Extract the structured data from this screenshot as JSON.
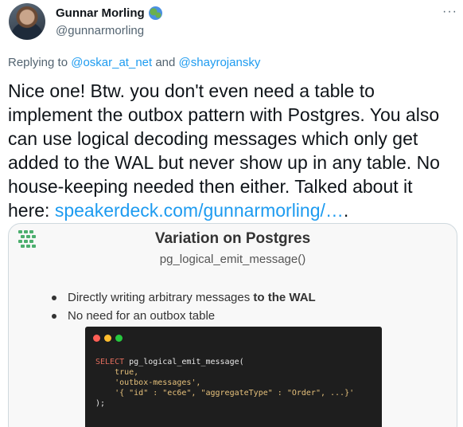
{
  "author": {
    "name": "Gunnar Morling",
    "handle": "@gunnarmorling",
    "badge_icon": "globe-icon"
  },
  "menu": {
    "more_label": "···"
  },
  "reply": {
    "prefix": "Replying to",
    "mention1": "@oskar_at_net",
    "conj": "and",
    "mention2": "@shayrojansky"
  },
  "tweet": {
    "text": "Nice one! Btw. you don't even need a table to implement the outbox pattern with Postgres. You also can use logical decoding messages which only get added to the WAL but never show up in any table. No house-keeping needed then either. Talked about it here: ",
    "link": "speakerdeck.com/gunnarmorling/…",
    "trailing": "."
  },
  "card": {
    "title": "Variation on Postgres",
    "subtitle": "pg_logical_emit_message()",
    "bullets": [
      {
        "text": "Directly writing arbitrary messages ",
        "bold": "to the WAL"
      },
      {
        "text": "No need for an outbox table",
        "bold": ""
      }
    ],
    "code": {
      "keyword": "SELECT",
      "line1": " pg_logical_emit_message(",
      "line2": "    true,",
      "line3": "    'outbox-messages',",
      "line4": "    '{ \"id\" : \"ec6e\", \"aggregateType\" : \"Order\", ...}'",
      "line5": ");"
    },
    "colors": {
      "logo": "#4caf6e",
      "dot_red": "#ff5f56",
      "dot_yellow": "#ffbd2e",
      "dot_green": "#27c93f"
    }
  }
}
